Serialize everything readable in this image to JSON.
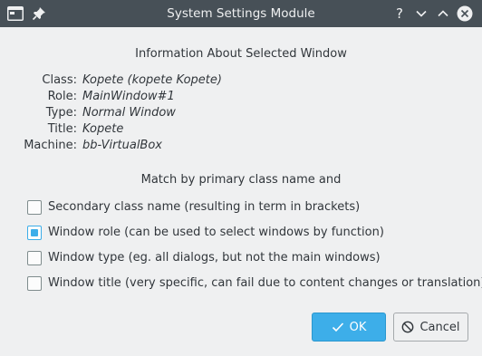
{
  "window": {
    "title": "System Settings Module",
    "help_glyph": "?"
  },
  "heading": "Information About Selected Window",
  "info": [
    {
      "label": "Class:",
      "value": "Kopete (kopete Kopete)"
    },
    {
      "label": "Role:",
      "value": "MainWindow#1"
    },
    {
      "label": "Type:",
      "value": "Normal Window"
    },
    {
      "label": "Title:",
      "value": "Kopete"
    },
    {
      "label": "Machine:",
      "value": "bb-VirtualBox"
    }
  ],
  "match_heading": "Match by primary class name and",
  "options": [
    {
      "label": "Secondary class name  (resulting in term in brackets)",
      "checked": false
    },
    {
      "label": "Window role (can be used to select windows by function)",
      "checked": true
    },
    {
      "label": "Window type (eg. all dialogs, but not the main windows)",
      "checked": false
    },
    {
      "label": "Window title (very specific, can fail due to content changes or translation)",
      "checked": false
    }
  ],
  "buttons": {
    "ok_label": "OK",
    "cancel_label": "Cancel"
  },
  "colors": {
    "titlebar": "#475057",
    "accent": "#3daee9",
    "background": "#eff0f1"
  },
  "icons": {
    "app": "window-app-icon",
    "pin": "pin-icon",
    "help": "help-icon",
    "minimize": "chevron-down-icon",
    "maximize": "chevron-up-icon",
    "close": "close-icon",
    "ok": "checkmark-icon",
    "cancel": "cancel-icon"
  }
}
